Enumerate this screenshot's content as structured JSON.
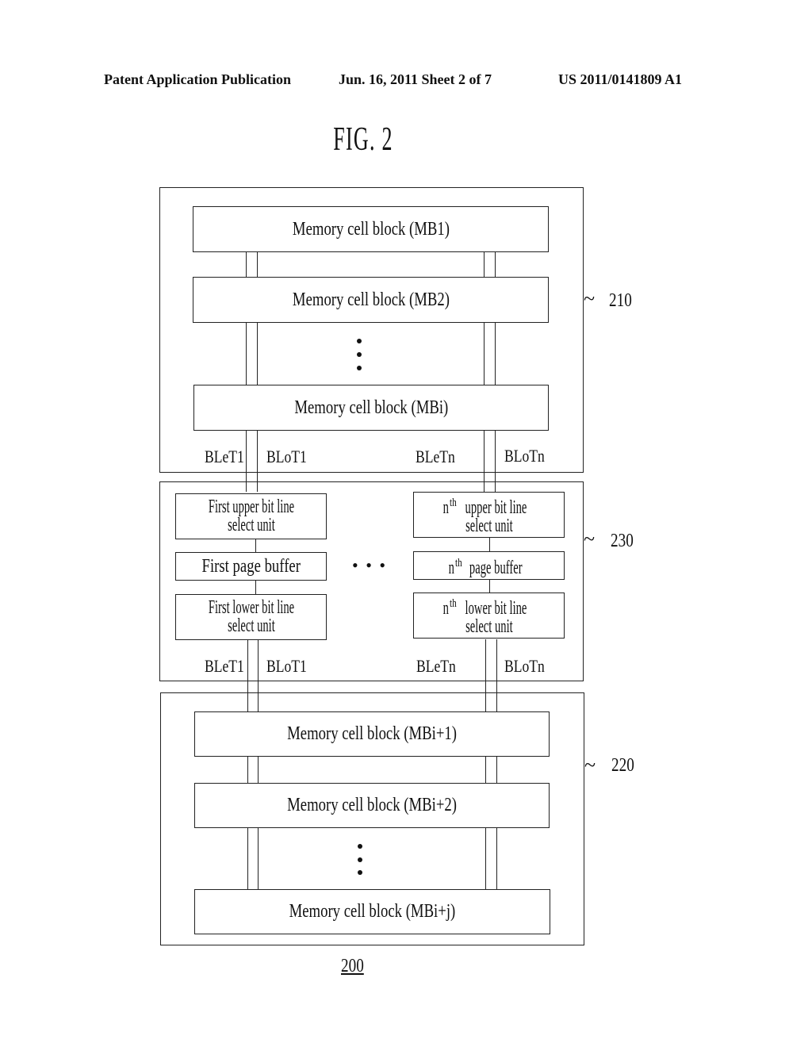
{
  "header": {
    "left": "Patent Application Publication",
    "center": "Jun. 16, 2011  Sheet 2 of 7",
    "right": "US 2011/0141809 A1"
  },
  "figure": {
    "title": "FIG. 2",
    "reference": "200"
  },
  "group_210": {
    "ref": "210",
    "blocks": [
      "Memory cell block (MB1)",
      "Memory cell block (MB2)",
      "Memory cell block (MBi)"
    ],
    "bitlines": [
      "BLeT1",
      "BLoT1",
      "BLeTn",
      "BLoTn"
    ]
  },
  "group_230": {
    "ref": "230",
    "col1": {
      "upper_1": "First upper bit line",
      "upper_2": "select unit",
      "buffer": "First page buffer",
      "lower_1": "First lower bit line",
      "lower_2": "select unit"
    },
    "coln": {
      "n": "n",
      "th": "th",
      "upper_1": " upper bit line",
      "upper_2": "select unit",
      "buffer": " page buffer",
      "lower_1": " lower bit line",
      "lower_2": "select unit"
    },
    "ellipsis": "•  •  •",
    "bitlines": [
      "BLeT1",
      "BLoT1",
      "BLeTn",
      "BLoTn"
    ]
  },
  "group_220": {
    "ref": "220",
    "blocks": [
      "Memory cell block (MBi+1)",
      "Memory cell block (MBi+2)",
      "Memory cell block (MBi+j)"
    ]
  }
}
